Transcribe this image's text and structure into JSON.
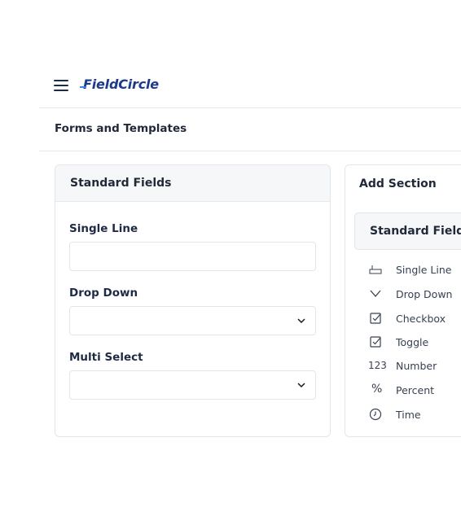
{
  "app": {
    "brand": "FieldCircle"
  },
  "page": {
    "title": "Forms and Templates"
  },
  "left_panel": {
    "title": "Standard Fields",
    "fields": [
      {
        "label": "Single Line",
        "type": "text",
        "value": ""
      },
      {
        "label": "Drop Down",
        "type": "select",
        "value": ""
      },
      {
        "label": "Multi Select",
        "type": "select",
        "value": ""
      }
    ]
  },
  "right_panel": {
    "title": "Add Section",
    "group_title": "Standard Fields",
    "items": [
      {
        "label": "Single Line",
        "icon": "single-line-icon"
      },
      {
        "label": "Drop Down",
        "icon": "chevron-down-icon"
      },
      {
        "label": "Checkbox",
        "icon": "checkbox-icon"
      },
      {
        "label": "Toggle",
        "icon": "checkbox-icon"
      },
      {
        "label": "Number",
        "icon": "number-icon",
        "glyph": "123"
      },
      {
        "label": "Percent",
        "icon": "percent-icon",
        "glyph": "%"
      },
      {
        "label": "Time",
        "icon": "clock-icon"
      }
    ]
  },
  "colors": {
    "brand": "#1e3a8a",
    "header_bg": "#f6f7f9",
    "border": "#e2e5ea"
  }
}
